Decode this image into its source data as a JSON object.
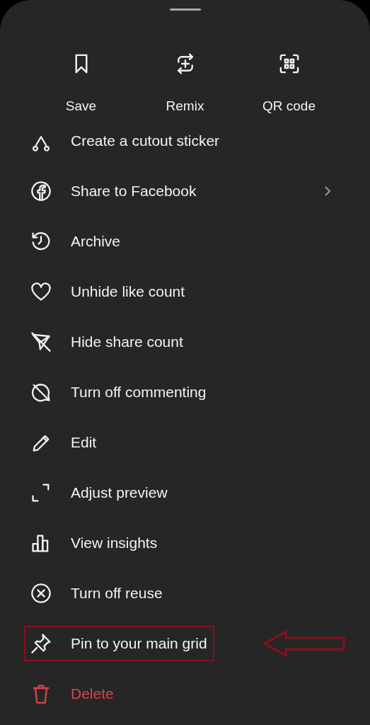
{
  "actions": [
    {
      "label": "Save"
    },
    {
      "label": "Remix"
    },
    {
      "label": "QR code"
    }
  ],
  "menu": [
    {
      "label": "Create a cutout sticker",
      "kind": "normal",
      "submenu": false,
      "highlighted": false
    },
    {
      "label": "Share to Facebook",
      "kind": "normal",
      "submenu": true,
      "highlighted": false
    },
    {
      "label": "Archive",
      "kind": "normal",
      "submenu": false,
      "highlighted": false
    },
    {
      "label": "Unhide like count",
      "kind": "normal",
      "submenu": false,
      "highlighted": false
    },
    {
      "label": "Hide share count",
      "kind": "normal",
      "submenu": false,
      "highlighted": false
    },
    {
      "label": "Turn off commenting",
      "kind": "normal",
      "submenu": false,
      "highlighted": false
    },
    {
      "label": "Edit",
      "kind": "normal",
      "submenu": false,
      "highlighted": false
    },
    {
      "label": "Adjust preview",
      "kind": "normal",
      "submenu": false,
      "highlighted": false
    },
    {
      "label": "View insights",
      "kind": "normal",
      "submenu": false,
      "highlighted": false
    },
    {
      "label": "Turn off reuse",
      "kind": "normal",
      "submenu": false,
      "highlighted": false
    },
    {
      "label": "Pin to your main grid",
      "kind": "normal",
      "submenu": false,
      "highlighted": true
    },
    {
      "label": "Delete",
      "kind": "danger",
      "submenu": false,
      "highlighted": false
    }
  ]
}
